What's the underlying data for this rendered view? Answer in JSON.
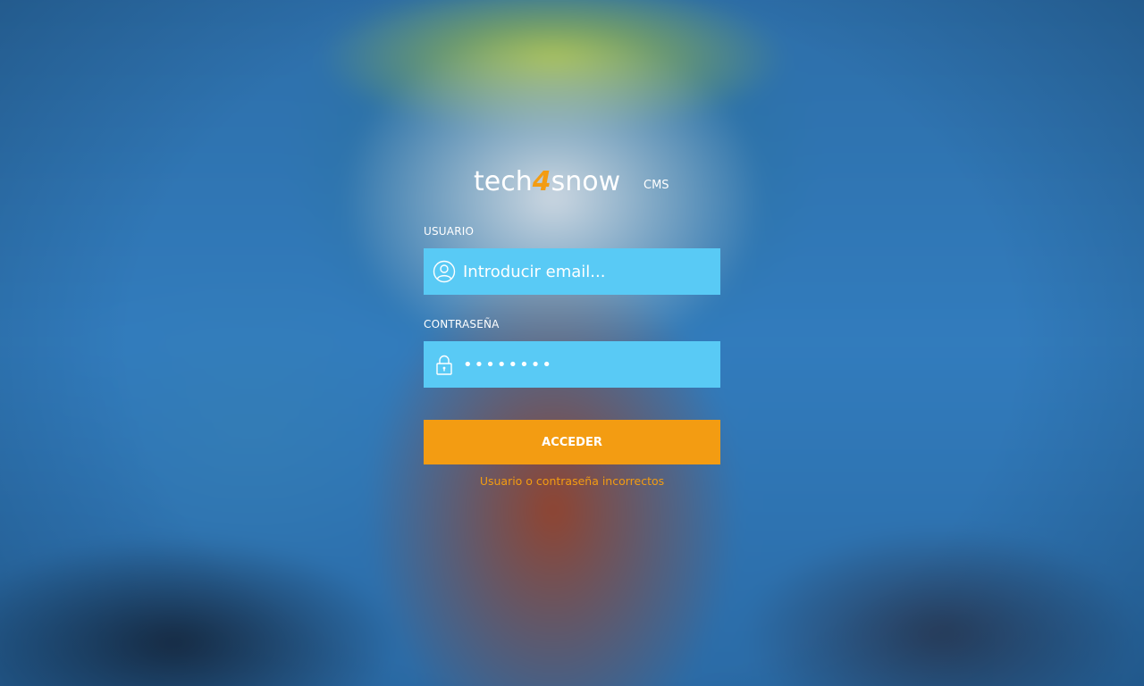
{
  "logo": {
    "word_before": "tech",
    "word_number": "4",
    "word_after": "snow",
    "suffix": "CMS"
  },
  "form": {
    "username_label": "USUARIO",
    "username_placeholder": "Introducir email...",
    "username_icon": "user-icon",
    "password_label": "CONTRASEÑA",
    "password_value": "••••••••",
    "password_icon": "lock-icon",
    "submit_label": "ACCEDER",
    "error_message": "Usuario o contraseña incorrectos"
  },
  "colors": {
    "accent": "#f39c12",
    "field_background": "#59caf5",
    "text": "#ffffff"
  }
}
